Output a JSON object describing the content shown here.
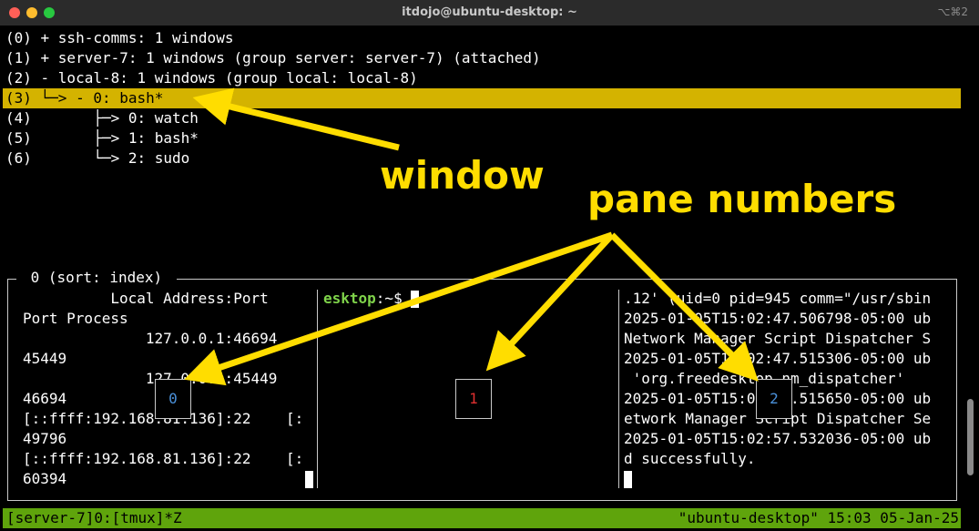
{
  "window": {
    "title": "itdojo@ubuntu-desktop: ~",
    "shortcut": "⌥⌘2"
  },
  "tree": {
    "lines": [
      "(0) + ssh-comms: 1 windows",
      "(1) + server-7: 1 windows (group server: server-7) (attached)",
      "(2) - local-8: 1 windows (group local: local-8)",
      "(3) └─> - 0: bash*",
      "(4)       ├─> 0: watch",
      "(5)       ├─> 1: bash*",
      "(6)       └─> 2: sudo"
    ],
    "selected_index": 3
  },
  "preview": {
    "label": " 0 (sort: index) ",
    "pane0": {
      "lines": [
        "          Local Address:Port",
        "Port Process",
        "              127.0.0.1:46694",
        "45449",
        "              127.0.0.1:45449",
        "46694",
        "[::ffff:192.168.81.136]:22    [:",
        "49796",
        "[::ffff:192.168.81.136]:22    [:",
        "60394"
      ],
      "number": "0"
    },
    "pane1": {
      "prompt_host": "esktop",
      "prompt_rest": ":~$ ",
      "number": "1"
    },
    "pane2": {
      "lines": [
        ".12' (uid=0 pid=945 comm=\"/usr/sbin",
        "2025-01-05T15:02:47.506798-05:00 ub",
        "Network Manager Script Dispatcher S",
        "2025-01-05T15:02:47.515306-05:00 ub",
        " 'org.freedesktop.nm_dispatcher'",
        "2025-01-05T15:02:47.515650-05:00 ub",
        "etwork Manager Script Dispatcher Se",
        "2025-01-05T15:02:57.532036-05:00 ub",
        "d successfully."
      ],
      "number": "2"
    }
  },
  "status": {
    "left": "[server-7]0:[tmux]*Z",
    "right": "\"ubuntu-desktop\" 15:03 05-Jan-25"
  },
  "annotations": {
    "window_label": "window",
    "pane_numbers_label": "pane numbers",
    "color": "#ffdd00"
  },
  "colors": {
    "highlight": "#d4b300",
    "status_bar": "#5fa40c",
    "prompt_green": "#7fd34a",
    "pane0_number": "#4a90d9",
    "pane1_number": "#e03030",
    "pane2_number": "#4a90d9"
  }
}
